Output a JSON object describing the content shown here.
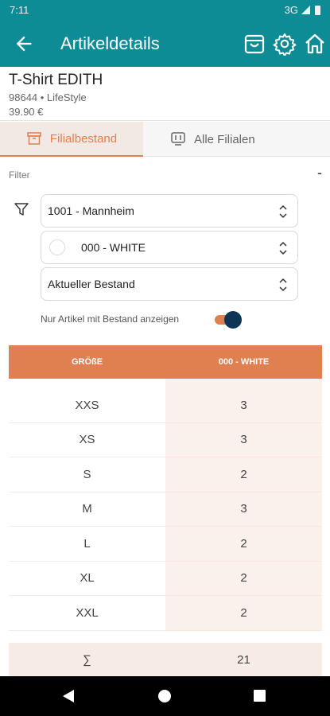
{
  "status": {
    "time": "7:11",
    "network": "3G"
  },
  "appbar": {
    "title": "Artikeldetails",
    "icons": [
      "arrow-back-icon",
      "shopping-bag-icon",
      "gear-icon",
      "home-icon"
    ]
  },
  "product": {
    "name": "T-Shirt EDITH",
    "meta": "98644 • LifeStyle",
    "price": "39.90 €"
  },
  "tabs": [
    {
      "label": "Filialbestand",
      "icon": "box-icon",
      "active": true
    },
    {
      "label": "Alle Filialen",
      "icon": "stores-icon",
      "active": false
    }
  ],
  "filter": {
    "label": "Filter",
    "collapse": "-",
    "store": "1001 - Mannheim",
    "color": "000 - WHITE",
    "stock_type": "Aktueller Bestand",
    "toggle_label": "Nur Artikel mit Bestand anzeigen",
    "toggle_on": true
  },
  "table": {
    "headers": [
      "GRÖßE",
      "000 - WHITE"
    ],
    "rows": [
      {
        "size": "XXS",
        "qty": "3"
      },
      {
        "size": "XS",
        "qty": "3"
      },
      {
        "size": "S",
        "qty": "2"
      },
      {
        "size": "M",
        "qty": "3"
      },
      {
        "size": "L",
        "qty": "2"
      },
      {
        "size": "XL",
        "qty": "2"
      },
      {
        "size": "XXL",
        "qty": "2"
      }
    ],
    "sum_symbol": "∑",
    "sum_value": "21"
  },
  "colors": {
    "primary": "#0e8c96",
    "accent": "#e07f4f",
    "toggle_knob": "#0e3555"
  }
}
